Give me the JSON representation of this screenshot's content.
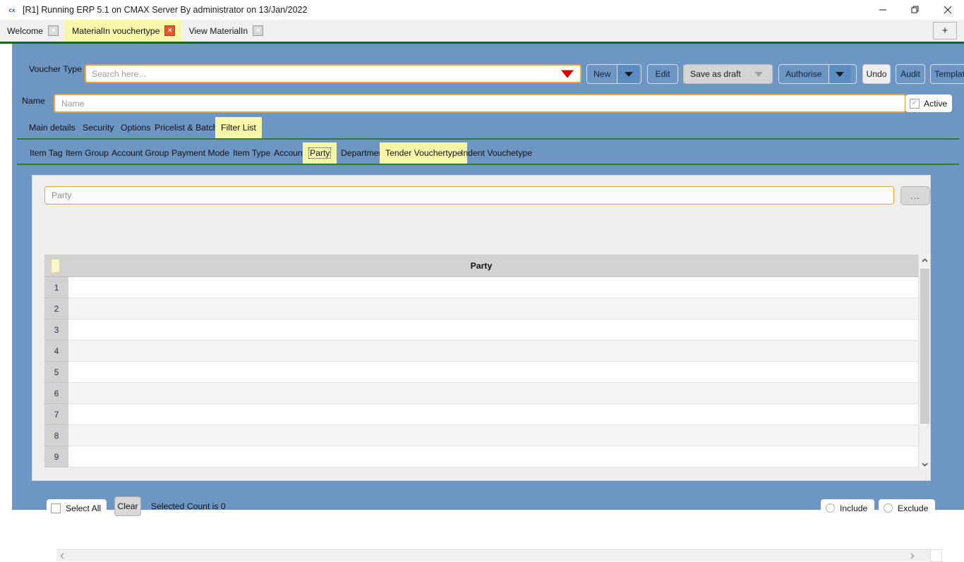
{
  "window": {
    "title": "[R1] Running ERP 5.1 on CMAX Server By administrator on 13/Jan/2022",
    "app_icon": "cx",
    "minimize_label": "minimize-icon",
    "maximize_label": "restore-icon",
    "close_label": "close-icon"
  },
  "tabstrip": {
    "tabs": [
      {
        "label": "Welcome",
        "active": false,
        "close": "×"
      },
      {
        "label": "MaterialIn vouchertype",
        "active": true,
        "close": "×"
      },
      {
        "label": "View MaterialIn",
        "active": false,
        "close": "×"
      }
    ],
    "new_tab_label": "+"
  },
  "form": {
    "voucher_type_label": "Voucher Type",
    "voucher_type_placeholder": "Search here...",
    "voucher_type_value": "",
    "name_label": "Name",
    "name_placeholder": "Name",
    "name_value": "",
    "active_label": "Active",
    "active_checked": true
  },
  "toolbar": {
    "new_label": "New",
    "edit_label": "Edit",
    "save_as_draft_label": "Save as draft",
    "authorise_label": "Authorise",
    "undo_label": "Undo",
    "audit_label": "Audit",
    "template_label": "Template"
  },
  "primary_tabs": [
    {
      "label": "Main details",
      "selected": false
    },
    {
      "label": "Security",
      "selected": false
    },
    {
      "label": "Options",
      "selected": false
    },
    {
      "label": "Pricelist & Batch",
      "selected": false
    },
    {
      "label": "Filter List",
      "selected": true
    }
  ],
  "secondary_tabs": [
    {
      "label": "Item Tag",
      "selected": false,
      "focused": false
    },
    {
      "label": "Item Group",
      "selected": false,
      "focused": false
    },
    {
      "label": "Account Group",
      "selected": false,
      "focused": false
    },
    {
      "label": "Payment Mode",
      "selected": false,
      "focused": false
    },
    {
      "label": "Item Type",
      "selected": false,
      "focused": false
    },
    {
      "label": "Account",
      "selected": false,
      "focused": false
    },
    {
      "label": "Party",
      "selected": true,
      "focused": true
    },
    {
      "label": "Department",
      "selected": false,
      "focused": false
    },
    {
      "label": "Tender Vouchertype",
      "selected": true,
      "focused": false
    },
    {
      "label": "Indent Vouchetype",
      "selected": false,
      "focused": false
    }
  ],
  "filter_panel": {
    "search_placeholder": "Party",
    "search_value": "",
    "ellipsis_label": "...",
    "grid": {
      "column_header": "Party",
      "rows": [
        {
          "number": "1",
          "value": ""
        },
        {
          "number": "2",
          "value": ""
        },
        {
          "number": "3",
          "value": ""
        },
        {
          "number": "4",
          "value": ""
        },
        {
          "number": "5",
          "value": ""
        },
        {
          "number": "6",
          "value": ""
        },
        {
          "number": "7",
          "value": ""
        },
        {
          "number": "8",
          "value": ""
        },
        {
          "number": "9",
          "value": ""
        }
      ]
    },
    "footer": {
      "select_all_label": "Select All",
      "select_all_checked": false,
      "clear_label": "Clear",
      "selected_count_text": "Selected Count is 0",
      "include_label": "Include",
      "include_selected": false,
      "exclude_label": "Exclude",
      "exclude_selected": false
    }
  },
  "colors": {
    "canvas_blue": "#6d96c4",
    "tab_highlight": "#f6f7a8",
    "accent_orange": "#f0a430",
    "rule_green": "#2f7a35",
    "title_green": "#136a19",
    "close_red": "#e8552e"
  }
}
